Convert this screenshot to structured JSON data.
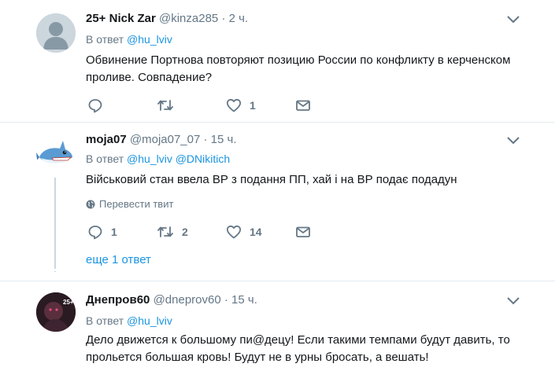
{
  "tweets": [
    {
      "name": "25+ Nick Zar",
      "handle": "@kinza285",
      "dot": "·",
      "time": "2 ч.",
      "reply_prefix": "В ответ",
      "mentions": [
        "@hu_lviv"
      ],
      "text": "Обвинение Портнова повторяют позицию России по конфликту в керченском проливе. Совпадение?",
      "reply_count": "",
      "retweet_count": "",
      "like_count": "1"
    },
    {
      "name": "moja07",
      "handle": "@moja07_07",
      "dot": "·",
      "time": "15 ч.",
      "reply_prefix": "В ответ",
      "mentions": [
        "@hu_lviv",
        "@DNikitich"
      ],
      "text": "Військовий стан ввела ВР з подання ПП, хай і на ВР подає подадун",
      "translate": "Перевести твит",
      "reply_count": "1",
      "retweet_count": "2",
      "like_count": "14",
      "more_replies": "еще 1 ответ"
    },
    {
      "name": "Днепров60",
      "handle": "@dneprov60",
      "dot": "·",
      "time": "15 ч.",
      "reply_prefix": "В ответ",
      "mentions": [
        "@hu_lviv"
      ],
      "text": "Дело движется к большому пи@децу! Если такими темпами будут давить, то прольется большая кровь! Будут не в урны бросать, а вешать!",
      "avatar_label": "25+"
    }
  ],
  "colors": {
    "link": "#1b95e0",
    "secondary": "#657786",
    "text": "#14171a",
    "divider": "#e6ecf0"
  },
  "icons": {
    "reply": "reply-icon",
    "retweet": "retweet-icon",
    "like": "heart-icon",
    "dm": "envelope-icon",
    "caret": "chevron-down-icon",
    "globe": "globe-icon"
  }
}
